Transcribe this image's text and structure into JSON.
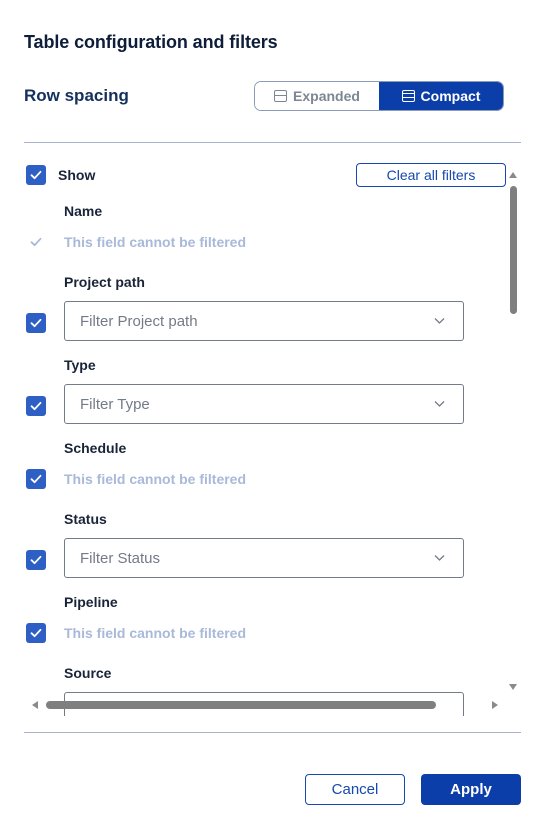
{
  "dialog": {
    "title": "Table configuration and filters"
  },
  "row_spacing": {
    "label": "Row spacing",
    "options": [
      {
        "label": "Expanded",
        "selected": false,
        "icon": "row-expanded-icon"
      },
      {
        "label": "Compact",
        "selected": true,
        "icon": "row-compact-icon"
      }
    ]
  },
  "columns": {
    "show_label": "Show",
    "show_checked": true,
    "clear_all_label": "Clear all filters",
    "fields": [
      {
        "label": "Name",
        "checked": true,
        "disabled": true,
        "filterable": false,
        "note": "This field cannot be filtered"
      },
      {
        "label": "Project path",
        "checked": true,
        "disabled": false,
        "filterable": true,
        "placeholder": "Filter Project path"
      },
      {
        "label": "Type",
        "checked": true,
        "disabled": false,
        "filterable": true,
        "placeholder": "Filter Type"
      },
      {
        "label": "Schedule",
        "checked": true,
        "disabled": false,
        "filterable": false,
        "note": "This field cannot be filtered"
      },
      {
        "label": "Status",
        "checked": true,
        "disabled": false,
        "filterable": true,
        "placeholder": "Filter Status"
      },
      {
        "label": "Pipeline",
        "checked": true,
        "disabled": false,
        "filterable": false,
        "note": "This field cannot be filtered"
      },
      {
        "label": "Source",
        "checked": true,
        "disabled": false,
        "filterable": true,
        "placeholder": ""
      }
    ]
  },
  "footer": {
    "cancel_label": "Cancel",
    "apply_label": "Apply"
  },
  "colors": {
    "primary": "#0c3eaa",
    "checkbox": "#2e5fc4",
    "disabled_text": "#a8b9d9",
    "heading": "#14305c"
  }
}
